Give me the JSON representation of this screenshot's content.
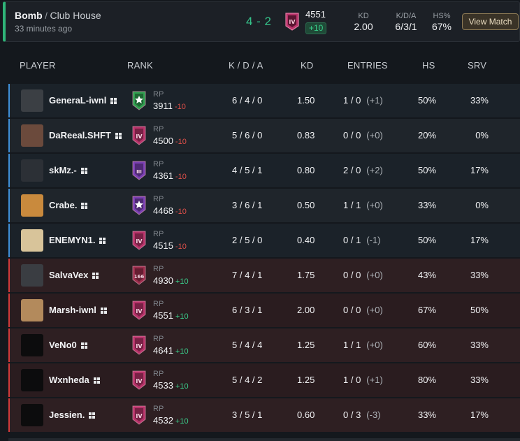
{
  "match": {
    "mode": "Bomb",
    "map": "Club House",
    "time_ago": "33 minutes ago",
    "score": "4 - 2",
    "rp": "4551",
    "rp_delta": "+10",
    "stats": [
      {
        "label": "KD",
        "value": "2.00"
      },
      {
        "label": "K/D/A",
        "value": "6/3/1"
      },
      {
        "label": "HS%",
        "value": "67%"
      }
    ],
    "view_label": "View Match"
  },
  "table": {
    "headers": {
      "player": "PLAYER",
      "rank": "RANK",
      "kda": "K / D / A",
      "kd": "KD",
      "entries": "ENTRIES",
      "hs": "HS",
      "srv": "SRV"
    },
    "rp_label": "RP",
    "rows": [
      {
        "team": "blue",
        "name": "GeneraL-iwnl",
        "rank_color": "#2f9e4f",
        "rank_icon": "star",
        "rp": "3911",
        "rp_delta": "-10",
        "delta_type": "neg",
        "kda": "6 / 4 / 0",
        "kd": "1.50",
        "entries": "1 / 0",
        "entries_delta": "(+1)",
        "hs": "50%",
        "srv": "33%",
        "avatar": "#3b3f44"
      },
      {
        "team": "blue",
        "name": "DaReeal.SHFT",
        "rank_color": "#b8336a",
        "rank_icon": "IV",
        "rp": "4500",
        "rp_delta": "-10",
        "delta_type": "neg",
        "kda": "5 / 6 / 0",
        "kd": "0.83",
        "entries": "0 / 0",
        "entries_delta": "(+0)",
        "hs": "20%",
        "srv": "0%",
        "avatar": "#6b4a3c"
      },
      {
        "team": "blue",
        "name": "skMz.-",
        "rank_color": "#7a3fb3",
        "rank_icon": "III",
        "rp": "4361",
        "rp_delta": "-10",
        "delta_type": "neg",
        "kda": "4 / 5 / 1",
        "kd": "0.80",
        "entries": "2 / 0",
        "entries_delta": "(+2)",
        "hs": "50%",
        "srv": "17%",
        "avatar": "#2c3036"
      },
      {
        "team": "blue",
        "name": "Crabe.",
        "rank_color": "#7a3fb3",
        "rank_icon": "star",
        "rp": "4468",
        "rp_delta": "-10",
        "delta_type": "neg",
        "kda": "3 / 6 / 1",
        "kd": "0.50",
        "entries": "1 / 1",
        "entries_delta": "(+0)",
        "hs": "33%",
        "srv": "0%",
        "avatar": "#c98a3d"
      },
      {
        "team": "blue",
        "name": "ENEMYN1.",
        "rank_color": "#b8336a",
        "rank_icon": "IV",
        "rp": "4515",
        "rp_delta": "-10",
        "delta_type": "neg",
        "kda": "2 / 5 / 0",
        "kd": "0.40",
        "entries": "0 / 1",
        "entries_delta": "(-1)",
        "hs": "50%",
        "srv": "17%",
        "avatar": "#d8c49a"
      },
      {
        "team": "red",
        "name": "SalvaVex",
        "rank_color": "#9b2d4c",
        "rank_icon": "166",
        "rp": "4930",
        "rp_delta": "+10",
        "delta_type": "pos",
        "kda": "7 / 4 / 1",
        "kd": "1.75",
        "entries": "0 / 0",
        "entries_delta": "(+0)",
        "hs": "43%",
        "srv": "33%",
        "avatar": "#3a3d42"
      },
      {
        "team": "red",
        "name": "Marsh-iwnl",
        "rank_color": "#b8336a",
        "rank_icon": "IV",
        "rp": "4551",
        "rp_delta": "+10",
        "delta_type": "pos",
        "kda": "6 / 3 / 1",
        "kd": "2.00",
        "entries": "0 / 0",
        "entries_delta": "(+0)",
        "hs": "67%",
        "srv": "50%",
        "avatar": "#b38a5c"
      },
      {
        "team": "red",
        "name": "VeNo0",
        "rank_color": "#b8336a",
        "rank_icon": "IV",
        "rp": "4641",
        "rp_delta": "+10",
        "delta_type": "pos",
        "kda": "5 / 4 / 4",
        "kd": "1.25",
        "entries": "1 / 1",
        "entries_delta": "(+0)",
        "hs": "60%",
        "srv": "33%",
        "avatar": "#0c0c0d"
      },
      {
        "team": "red",
        "name": "Wxnheda",
        "rank_color": "#b8336a",
        "rank_icon": "IV",
        "rp": "4533",
        "rp_delta": "+10",
        "delta_type": "pos",
        "kda": "5 / 4 / 2",
        "kd": "1.25",
        "entries": "1 / 0",
        "entries_delta": "(+1)",
        "hs": "80%",
        "srv": "33%",
        "avatar": "#0c0c0d"
      },
      {
        "team": "red",
        "name": "Jessien.",
        "rank_color": "#b8336a",
        "rank_icon": "IV",
        "rp": "4532",
        "rp_delta": "+10",
        "delta_type": "pos",
        "kda": "3 / 5 / 1",
        "kd": "0.60",
        "entries": "0 / 3",
        "entries_delta": "(-3)",
        "hs": "33%",
        "srv": "17%",
        "avatar": "#0c0c0d"
      }
    ]
  },
  "colors": {
    "win_green": "#35c189",
    "blue_team": "#3f8fd8",
    "red_team": "#d23a3a",
    "negative": "#e2504a",
    "positive": "#3ad08c"
  }
}
